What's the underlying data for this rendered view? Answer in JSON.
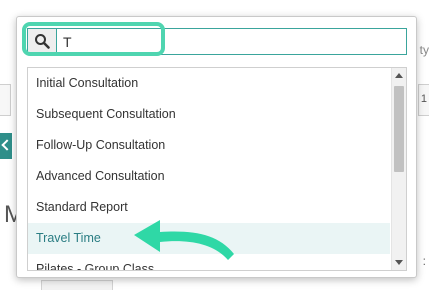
{
  "background": {
    "letter": "M",
    "right_fragment": "ty",
    "right_number": "1",
    "right_dots": ":"
  },
  "search": {
    "value": "T",
    "placeholder": ""
  },
  "items": [
    {
      "label": "Initial Consultation"
    },
    {
      "label": "Subsequent Consultation"
    },
    {
      "label": "Follow-Up Consultation"
    },
    {
      "label": "Advanced Consultation"
    },
    {
      "label": "Standard Report"
    },
    {
      "label": "Travel Time"
    },
    {
      "label": "Pilates - Group Class"
    }
  ],
  "active_index": 5,
  "scroll_position": 0,
  "colors": {
    "accent": "#3aa59c",
    "highlight_ring": "#4fd5b0",
    "active_row_bg": "#eaf5f5",
    "active_row_text": "#2a7d83",
    "annotation_arrow": "#2fd8a6"
  },
  "icons": {
    "search": "magnifier-icon",
    "annotation": "curved-arrow-icon"
  }
}
